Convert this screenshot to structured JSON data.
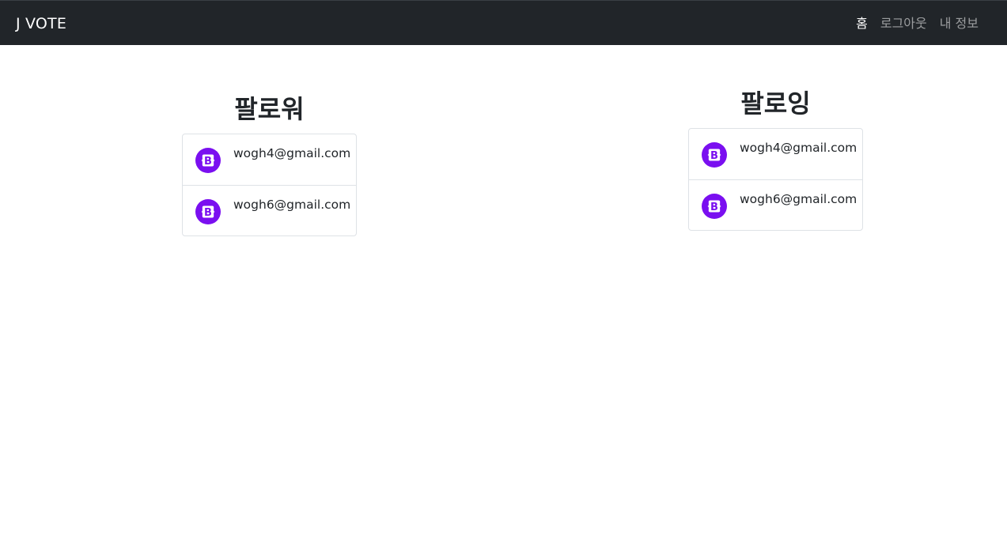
{
  "navbar": {
    "brand": "J VOTE",
    "links": [
      {
        "label": "홈",
        "active": true
      },
      {
        "label": "로그아웃",
        "active": false
      },
      {
        "label": "내 정보",
        "active": false
      }
    ]
  },
  "followers": {
    "title": "팔로워",
    "items": [
      {
        "email": "wogh4@gmail.com",
        "avatar_icon": "bootstrap-logo-icon"
      },
      {
        "email": "wogh6@gmail.com",
        "avatar_icon": "bootstrap-logo-icon"
      }
    ]
  },
  "following": {
    "title": "팔로잉",
    "items": [
      {
        "email": "wogh4@gmail.com",
        "avatar_icon": "bootstrap-logo-icon"
      },
      {
        "email": "wogh6@gmail.com",
        "avatar_icon": "bootstrap-logo-icon"
      }
    ]
  },
  "colors": {
    "navbar_bg": "#212529",
    "avatar_purple": "#7a0ff0",
    "border": "#dee2e6"
  }
}
